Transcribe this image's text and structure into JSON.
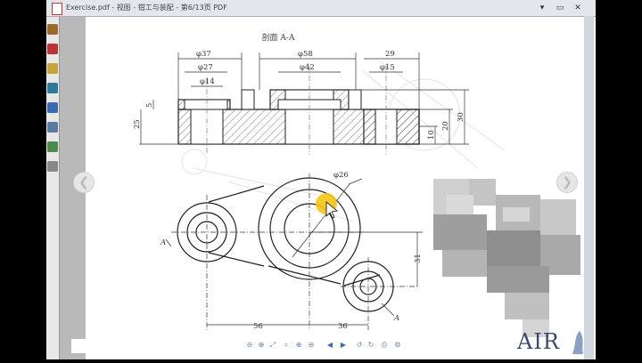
{
  "window": {
    "title": "Exercise.pdf - 视图 - 钳工与装配 - 第6/13页 PDF",
    "minimize_label": "▾",
    "restore_label": "▭",
    "close_label": "✕"
  },
  "toolbar": {
    "tools": [
      "hand-icon",
      "select-icon",
      "text-icon",
      "snapshot-icon",
      "bookmark-icon",
      "find-icon",
      "link-icon",
      "page-icon"
    ]
  },
  "drawing": {
    "section_title": "剖面 A-A",
    "dims": {
      "d37": "φ37",
      "d27": "φ27",
      "d14": "φ14",
      "d58": "φ58",
      "d42": "φ42",
      "d15": "φ15",
      "w29": "29",
      "h5": "5",
      "h25": "25",
      "h10": "10",
      "h20": "20",
      "h30": "30",
      "d26": "φ26",
      "h31": "31",
      "w56": "56",
      "w36": "36",
      "labelA1": "A",
      "labelA2": "A"
    }
  },
  "navigation": {
    "prev_label": "❮",
    "next_label": "❯"
  },
  "bottom_toolbar": {
    "buttons": [
      "⊖",
      "⊕",
      "⤢",
      "⌕",
      "⊕",
      "⊖",
      "◀",
      "▶",
      "↺",
      "↻",
      "⎙",
      "⚙"
    ]
  },
  "logo": {
    "text": "AIR"
  }
}
